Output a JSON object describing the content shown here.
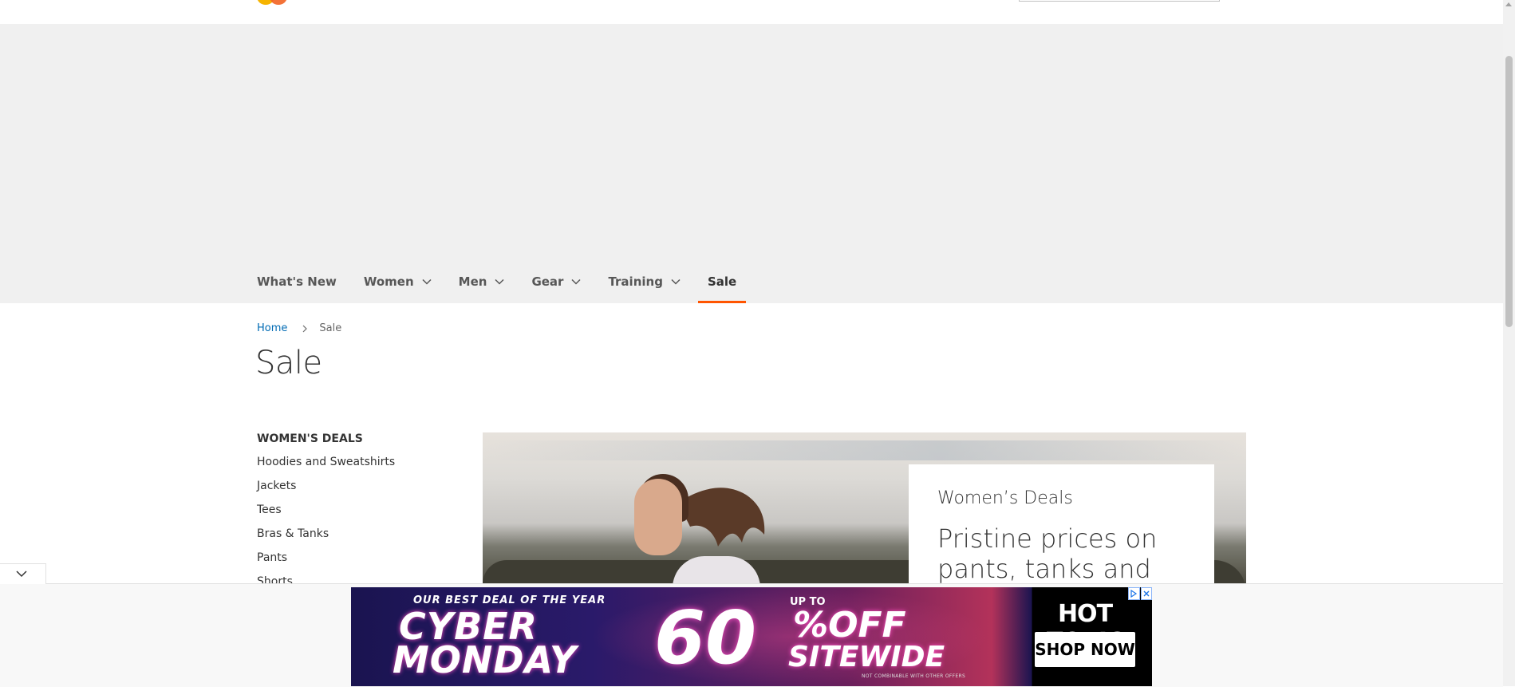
{
  "nav": {
    "items": [
      {
        "label": "What's New",
        "has_dropdown": false
      },
      {
        "label": "Women",
        "has_dropdown": true
      },
      {
        "label": "Men",
        "has_dropdown": true
      },
      {
        "label": "Gear",
        "has_dropdown": true
      },
      {
        "label": "Training",
        "has_dropdown": true
      },
      {
        "label": "Sale",
        "has_dropdown": false,
        "active": true
      }
    ],
    "active_color": "#ff5501"
  },
  "breadcrumb": {
    "home": "Home",
    "current": "Sale"
  },
  "page": {
    "title": "Sale"
  },
  "sidebar": {
    "heading": "WOMEN'S DEALS",
    "links": [
      "Hoodies and Sweatshirts",
      "Jackets",
      "Tees",
      "Bras & Tanks",
      "Pants",
      "Shorts"
    ]
  },
  "hero": {
    "subtitle": "Women’s Deals",
    "headline": "Pristine prices on pants, tanks and"
  },
  "ad": {
    "line1": "OUR BEST DEAL OF THE YEAR",
    "cyber": "CYBER",
    "monday": "MONDAY",
    "up_to": "UP TO",
    "percent": "60",
    "off": "%OFF",
    "sitewide": "SITEWIDE",
    "fine_print": "NOT COMBINABLE WITH OTHER OFFERS",
    "brand": "HOT TOPIC",
    "cta": "SHOP NOW"
  },
  "icons": {
    "chevron": "chevron-down-icon",
    "breadcrumb_sep": "chevron-right-icon",
    "ad_choices": "adchoices-icon",
    "ad_close": "close-icon",
    "collapse": "chevron-down-icon"
  }
}
